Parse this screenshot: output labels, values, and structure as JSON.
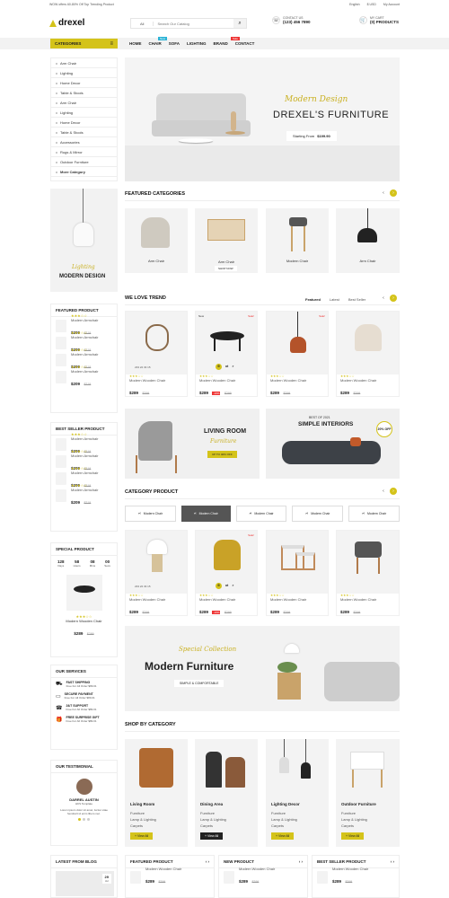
{
  "topbar": {
    "promo": "WOW offers 60-80% Off Top Trending Product",
    "language": "English",
    "currency": "$ USD",
    "account": "My Account"
  },
  "header": {
    "logo": "drexel",
    "search_category": "All",
    "search_placeholder": "Search Our Catalog",
    "contact_label": "CONTACT US",
    "contact_phone": "(123) 456 7890",
    "cart_label": "MY CART",
    "cart_count": "(0) PRODUCTS"
  },
  "nav": {
    "categories_label": "CATEGORIES",
    "items": [
      "HOME",
      "CHAIR",
      "SOFA",
      "LIGHTING",
      "BRAND",
      "CONTACT"
    ],
    "badges": {
      "chair": "New",
      "brand": "Sale"
    }
  },
  "categories": [
    "Arm Chair",
    "Lighting",
    "Home Decor",
    "Table & Stools",
    "Arm Chair",
    "Lighting",
    "Home Decor",
    "Table & Stools",
    "Accessories",
    "Rugs & Mirror",
    "Outdoor Furniture",
    "More Category"
  ],
  "hero": {
    "script": "Modern Design",
    "title": "DREXEL'S FURNITURE",
    "price_label": "Starting From",
    "price": "$199.90"
  },
  "side_banner": {
    "script": "Lighting",
    "title": "MODERN DESIGN"
  },
  "featured_categories": {
    "title": "FEATURED CATEGORIES",
    "items": [
      "Arm Chair",
      "Arm Chair",
      "Modern Chair",
      "Arm Chair"
    ],
    "shop_now": "SHOP NOW"
  },
  "love_trend": {
    "title": "WE LOVE TREND",
    "tabs": [
      "Featured",
      "Latest",
      "Best Seller"
    ],
    "sale": "Sale!",
    "new": "New",
    "countdown": "233  22  33  15",
    "products": [
      {
        "name": "Modern Wooden Chair",
        "price": "$289",
        "old": "$299"
      },
      {
        "name": "Modern Wooden Chair",
        "price": "$289",
        "old": "$299",
        "discount": "-10%"
      },
      {
        "name": "Modern Wooden Chair",
        "price": "$289",
        "old": "$299"
      },
      {
        "name": "Modern Wooden Chair",
        "price": "$289",
        "old": "$299"
      }
    ]
  },
  "featured_product": {
    "title": "FEATURED PRODUCT",
    "items": [
      {
        "name": "Modern Armchair",
        "price": "$209",
        "old": "$219"
      },
      {
        "name": "Modern Armchair",
        "price": "$209",
        "old": "$219"
      },
      {
        "name": "Modern Armchair",
        "price": "$209",
        "old": "$219"
      },
      {
        "name": "Modern Armchair",
        "price": "$209",
        "old": "$219"
      }
    ]
  },
  "best_seller": {
    "title": "BEST SELLER PRODUCT",
    "items": [
      {
        "name": "Modern Armchair",
        "price": "$209",
        "old": "$219"
      },
      {
        "name": "Modern Armchair",
        "price": "$209",
        "old": "$219"
      },
      {
        "name": "Modern Armchair",
        "price": "$209",
        "old": "$219"
      },
      {
        "name": "Modern Armchair",
        "price": "$209",
        "old": "$219"
      }
    ]
  },
  "special_product": {
    "title": "SPECIAL PRODUCT",
    "timer": [
      {
        "v": "128",
        "l": "Days"
      },
      {
        "v": "58",
        "l": "Hours"
      },
      {
        "v": "08",
        "l": "Mins"
      },
      {
        "v": "00",
        "l": "Secs"
      }
    ],
    "name": "Modern Wooden Chair",
    "price": "$289",
    "old": "$299"
  },
  "banners": {
    "living_title": "LIVING ROOM",
    "living_script": "Furniture",
    "living_btn": "UP TO 40% OFF",
    "simple_top": "BEST OF 2021",
    "simple_title": "SIMPLE INTERIORS",
    "simple_badge": "20% OFF"
  },
  "category_product": {
    "title": "CATEGORY PRODUCT",
    "tabs": [
      "Modern Chair",
      "Modern Chair",
      "Modern Chair",
      "Modern Chair",
      "Modern Chair"
    ],
    "sale": "Sale!",
    "countdown": "233  22  33  15",
    "products": [
      {
        "name": "Modern Wooden Chair",
        "price": "$289",
        "old": "$299"
      },
      {
        "name": "Modern Wooden Chair",
        "price": "$289",
        "old": "$299",
        "discount": "-10%"
      },
      {
        "name": "Modern Wooden Chair",
        "price": "$289",
        "old": "$299"
      },
      {
        "name": "Modern Wooden Chair",
        "price": "$289",
        "old": "$299"
      }
    ]
  },
  "services": {
    "title": "OUR SERVICES",
    "items": [
      {
        "name": "FAST SHIPPING",
        "sub": "Free For All Order $89.01"
      },
      {
        "name": "SECURE PAYMENT",
        "sub": "Free For All Order $89.01"
      },
      {
        "name": "24/7 SUPPORT",
        "sub": "Free For All Order $89.01"
      },
      {
        "name": "FREE SURPRISE GIFT",
        "sub": "Free For All Order $89.01"
      }
    ]
  },
  "special_collection": {
    "script": "Special Collection",
    "title": "Modern Furniture",
    "sub": "SIMPLE & COMFORTABLE"
  },
  "testimonial": {
    "title": "OUR TESTIMONIAL",
    "name": "DARREL AUSTIN",
    "role": "HKS Template",
    "text": "Lorem ipsum dolor sit amet, luctus vitae hendrerit id enim libero nec."
  },
  "shop_by_category": {
    "title": "SHOP BY CATEGORY",
    "view_all": "+ View All",
    "items": [
      {
        "name": "Living Room",
        "subs": [
          "Furniture",
          "Lamp & Lighting",
          "Carpets"
        ]
      },
      {
        "name": "Dining Area",
        "subs": [
          "Furniture",
          "Lamp & Lighting",
          "Carpets"
        ]
      },
      {
        "name": "Lighting Decor",
        "subs": [
          "Furniture",
          "Lamp & Lighting",
          "Carpets"
        ]
      },
      {
        "name": "Outdoor Furniture",
        "subs": [
          "Furniture",
          "Lamp & Lighting",
          "Carpets"
        ]
      }
    ]
  },
  "blog": {
    "title": "LATEST FROM BLOG",
    "date": "29",
    "month": "Jul"
  },
  "bottom_lists": [
    {
      "title": "FEATURED PRODUCT",
      "item": "Modern Wooden Chair",
      "price": "$289",
      "old": "$299"
    },
    {
      "title": "NEW PRODUCT",
      "item": "Modern Wooden Chair",
      "price": "$289",
      "old": "$299"
    },
    {
      "title": "BEST SELLER PRODUCT",
      "item": "Modern Wooden Chair",
      "price": "$289",
      "old": "$299"
    }
  ],
  "colors": {
    "accent": "#d4c31a",
    "dark": "#222222"
  }
}
